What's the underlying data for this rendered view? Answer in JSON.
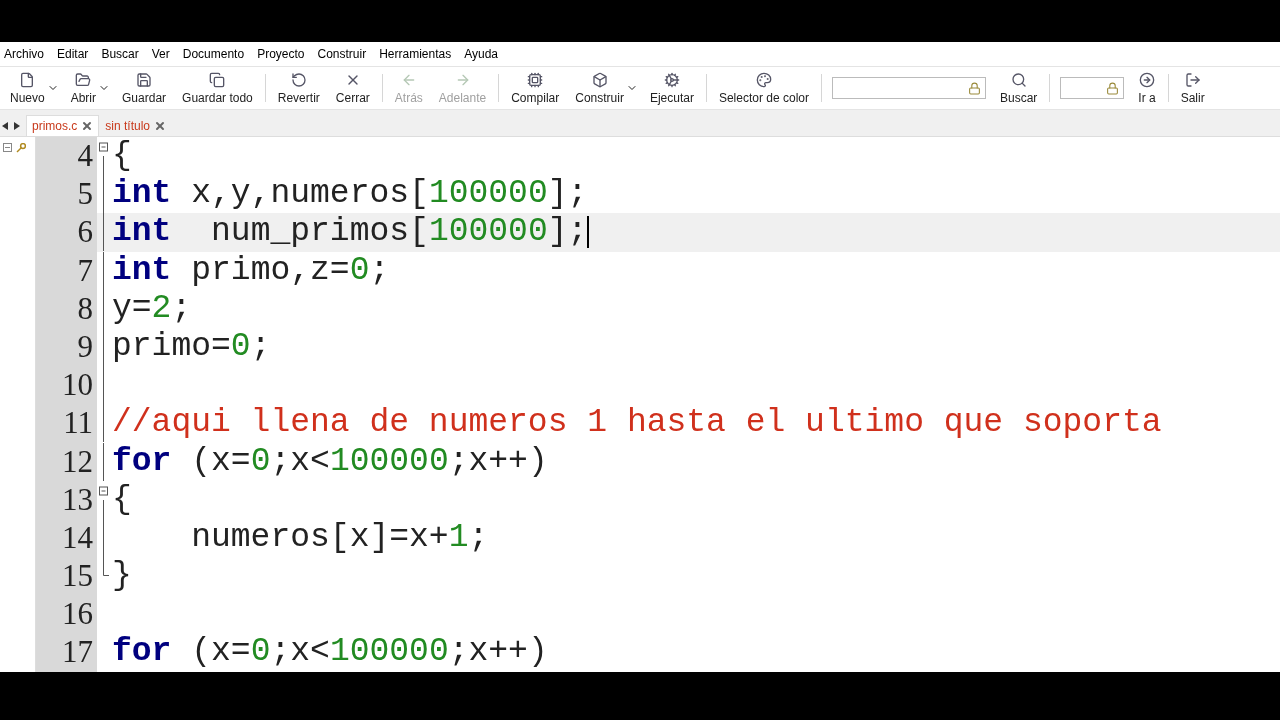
{
  "menu": [
    "Archivo",
    "Editar",
    "Buscar",
    "Ver",
    "Documento",
    "Proyecto",
    "Construir",
    "Herramientas",
    "Ayuda"
  ],
  "toolbar": [
    {
      "kind": "button",
      "label": "Nuevo",
      "disabled": false,
      "dropdown": true
    },
    {
      "kind": "button",
      "label": "Abrir",
      "disabled": false,
      "dropdown": true
    },
    {
      "kind": "button",
      "label": "Guardar",
      "disabled": false
    },
    {
      "kind": "button",
      "label": "Guardar todo",
      "disabled": false
    },
    {
      "kind": "separator"
    },
    {
      "kind": "button",
      "label": "Revertir",
      "disabled": false
    },
    {
      "kind": "button",
      "label": "Cerrar",
      "disabled": false
    },
    {
      "kind": "separator"
    },
    {
      "kind": "button",
      "label": "Atrás",
      "disabled": true
    },
    {
      "kind": "button",
      "label": "Adelante",
      "disabled": true
    },
    {
      "kind": "separator"
    },
    {
      "kind": "button",
      "label": "Compilar",
      "disabled": false
    },
    {
      "kind": "button",
      "label": "Construir",
      "disabled": false,
      "dropdown": true
    },
    {
      "kind": "button",
      "label": "Ejecutar",
      "disabled": false
    },
    {
      "kind": "separator"
    },
    {
      "kind": "button",
      "label": "Selector de color",
      "disabled": false
    },
    {
      "kind": "separator"
    },
    {
      "kind": "widefield"
    },
    {
      "kind": "button",
      "label": "Buscar",
      "disabled": false
    },
    {
      "kind": "separator"
    },
    {
      "kind": "field"
    },
    {
      "kind": "button",
      "label": "Ir a",
      "disabled": false
    },
    {
      "kind": "separator"
    },
    {
      "kind": "button",
      "label": "Salir",
      "disabled": false
    }
  ],
  "tabs": [
    {
      "label": "primos.c",
      "selected": true
    },
    {
      "label": "sin título",
      "selected": false
    }
  ],
  "editor": {
    "lines": [
      {
        "number": "4",
        "kind": "start",
        "current": false,
        "tokens": [
          {
            "kind": "plain",
            "text": "{"
          }
        ]
      },
      {
        "number": "5",
        "kind": "inside",
        "current": false,
        "tokens": [
          {
            "kind": "keyword",
            "text": "int"
          },
          {
            "kind": "plain",
            "text": " x,y,numeros["
          },
          {
            "kind": "number",
            "text": "100000"
          },
          {
            "kind": "plain",
            "text": "];"
          }
        ]
      },
      {
        "number": "6",
        "kind": "inside",
        "current": true,
        "tokens": [
          {
            "kind": "keyword",
            "text": "int"
          },
          {
            "kind": "plain",
            "text": "  num_primos["
          },
          {
            "kind": "number",
            "text": "100000"
          },
          {
            "kind": "plain",
            "text": "];"
          }
        ]
      },
      {
        "number": "7",
        "kind": "inside",
        "current": false,
        "tokens": [
          {
            "kind": "keyword",
            "text": "int"
          },
          {
            "kind": "plain",
            "text": " primo,z="
          },
          {
            "kind": "number",
            "text": "0"
          },
          {
            "kind": "plain",
            "text": ";"
          }
        ]
      },
      {
        "number": "8",
        "kind": "inside",
        "current": false,
        "tokens": [
          {
            "kind": "plain",
            "text": "y="
          },
          {
            "kind": "number",
            "text": "2"
          },
          {
            "kind": "plain",
            "text": ";"
          }
        ]
      },
      {
        "number": "9",
        "kind": "inside",
        "current": false,
        "tokens": [
          {
            "kind": "plain",
            "text": "primo="
          },
          {
            "kind": "number",
            "text": "0"
          },
          {
            "kind": "plain",
            "text": ";"
          }
        ]
      },
      {
        "number": "10",
        "kind": "inside",
        "current": false
      },
      {
        "number": "11",
        "kind": "inside",
        "current": false,
        "tokens": [
          {
            "kind": "comment",
            "text": "//aqui llena de numeros 1 hasta el ultimo que soporta"
          }
        ]
      },
      {
        "number": "12",
        "kind": "inside",
        "current": false,
        "tokens": [
          {
            "kind": "keyword",
            "text": "for"
          },
          {
            "kind": "plain",
            "text": " (x="
          },
          {
            "kind": "number",
            "text": "0"
          },
          {
            "kind": "plain",
            "text": ";x<"
          },
          {
            "kind": "number",
            "text": "100000"
          },
          {
            "kind": "plain",
            "text": ";x++)"
          }
        ]
      },
      {
        "number": "13",
        "kind": "start",
        "current": false,
        "tokens": [
          {
            "kind": "plain",
            "text": "{"
          }
        ]
      },
      {
        "number": "14",
        "kind": "inside",
        "current": false,
        "tokens": [
          {
            "kind": "plain",
            "text": "    numeros[x]=x+"
          },
          {
            "kind": "number",
            "text": "1"
          },
          {
            "kind": "plain",
            "text": ";"
          }
        ]
      },
      {
        "number": "15",
        "kind": "end",
        "current": false,
        "tokens": [
          {
            "kind": "plain",
            "text": "}"
          }
        ]
      },
      {
        "number": "16",
        "kind": "plain",
        "current": false
      },
      {
        "number": "17",
        "kind": "plain",
        "current": false,
        "tokens": [
          {
            "kind": "keyword",
            "text": "for"
          },
          {
            "kind": "plain",
            "text": " (x="
          },
          {
            "kind": "number",
            "text": "0"
          },
          {
            "kind": "plain",
            "text": ";x<"
          },
          {
            "kind": "number",
            "text": "100000"
          },
          {
            "kind": "plain",
            "text": ";x++)"
          }
        ]
      }
    ]
  }
}
